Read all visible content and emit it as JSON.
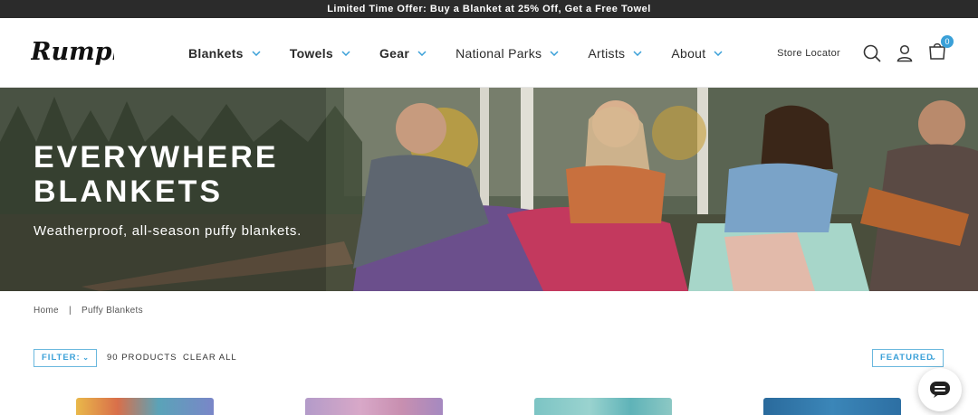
{
  "promo": {
    "text": "Limited Time Offer: Buy a Blanket at 25% Off, Get a Free Towel"
  },
  "header": {
    "logo_text": "Rumpl",
    "nav": [
      {
        "label": "Blankets",
        "bold": true
      },
      {
        "label": "Towels",
        "bold": true
      },
      {
        "label": "Gear",
        "bold": true
      },
      {
        "label": "National Parks",
        "bold": false
      },
      {
        "label": "Artists",
        "bold": false
      },
      {
        "label": "About",
        "bold": false
      }
    ],
    "store_locator": "Store Locator",
    "cart_count": "0",
    "icons": [
      "search-icon",
      "account-icon",
      "cart-icon",
      "chevron-down-icon"
    ]
  },
  "hero": {
    "title_line1": "EVERYWHERE",
    "title_line2": "BLANKETS",
    "subtitle": "Weatherproof, all-season puffy blankets."
  },
  "breadcrumb": {
    "home": "Home",
    "separator": "|",
    "current": "Puffy Blankets"
  },
  "toolbar": {
    "filter_label": "FILTER:",
    "product_count": "90 PRODUCTS",
    "clear_all": "CLEAR ALL",
    "sort_label": "FEATURED"
  },
  "colors": {
    "accent": "#3aa0d8",
    "promo_bg": "#2b2b2b"
  }
}
